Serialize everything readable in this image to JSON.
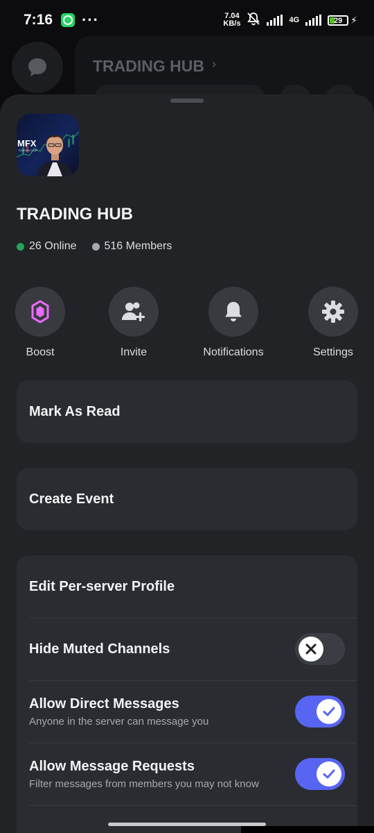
{
  "status_bar": {
    "time": "7:16",
    "more": "···",
    "net_speed_value": "7.04",
    "net_speed_unit": "KB/s",
    "network": "4G",
    "battery": "29",
    "battery_level": 0.29
  },
  "background": {
    "server_title": "TRADING HUB"
  },
  "server": {
    "name": "TRADING HUB",
    "icon_brand": "MFX",
    "icon_tagline": "TRADING HUB",
    "online": "26 Online",
    "members": "516 Members"
  },
  "actions": [
    {
      "label": "Boost",
      "icon": "boost-gem-icon"
    },
    {
      "label": "Invite",
      "icon": "invite-person-icon"
    },
    {
      "label": "Notifications",
      "icon": "bell-icon"
    },
    {
      "label": "Settings",
      "icon": "gear-icon"
    }
  ],
  "menu": {
    "mark_as_read": "Mark As Read",
    "create_event": "Create Event",
    "edit_profile": "Edit Per-server Profile",
    "hide_muted": {
      "label": "Hide Muted Channels",
      "enabled": false
    },
    "allow_dm": {
      "label": "Allow Direct Messages",
      "sub": "Anyone in the server can message you",
      "enabled": true
    },
    "allow_requests": {
      "label": "Allow Message Requests",
      "sub": "Filter messages from members you may not know",
      "enabled": true
    }
  },
  "colors": {
    "accent": "#5865f2",
    "online": "#23a55a",
    "boost": "#eb6bff"
  }
}
